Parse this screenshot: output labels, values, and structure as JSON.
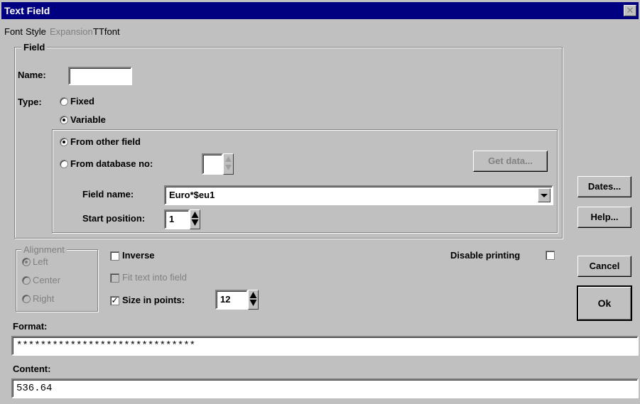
{
  "window": {
    "title": "Text Field",
    "close_glyph": "✕"
  },
  "menu": {
    "font": "Font",
    "style": "Style",
    "expansion": "Expansion",
    "ttfont": "TTfont"
  },
  "field_group": {
    "legend": "Field",
    "name_label": "Name:",
    "name_value": "",
    "type_label": "Type:",
    "fixed_label": "Fixed",
    "variable_label": "Variable",
    "from_other_label": "From other field",
    "from_db_label": "From database no:",
    "from_db_value": "",
    "get_data_label": "Get data...",
    "field_name_label": "Field name:",
    "field_name_value": "Euro*$eu1",
    "start_position_label": "Start position:",
    "start_position_value": "1",
    "selected_type": "variable",
    "selected_source": "from-other-field"
  },
  "alignment": {
    "legend": "Alignment",
    "left": "Left",
    "center": "Center",
    "right": "Right",
    "selected": "left"
  },
  "options": {
    "inverse_label": "Inverse",
    "inverse_checked": false,
    "fit_label": "Fit text into field",
    "fit_checked": false,
    "size_label": "Size in points:",
    "size_checked": true,
    "size_value": "12",
    "disable_printing_label": "Disable printing",
    "disable_printing_checked": false
  },
  "format": {
    "label": "Format:",
    "value": "******************************"
  },
  "content": {
    "label": "Content:",
    "value": "536.64"
  },
  "buttons": {
    "dates": "Dates...",
    "help": "Help...",
    "cancel": "Cancel",
    "ok": "Ok"
  }
}
